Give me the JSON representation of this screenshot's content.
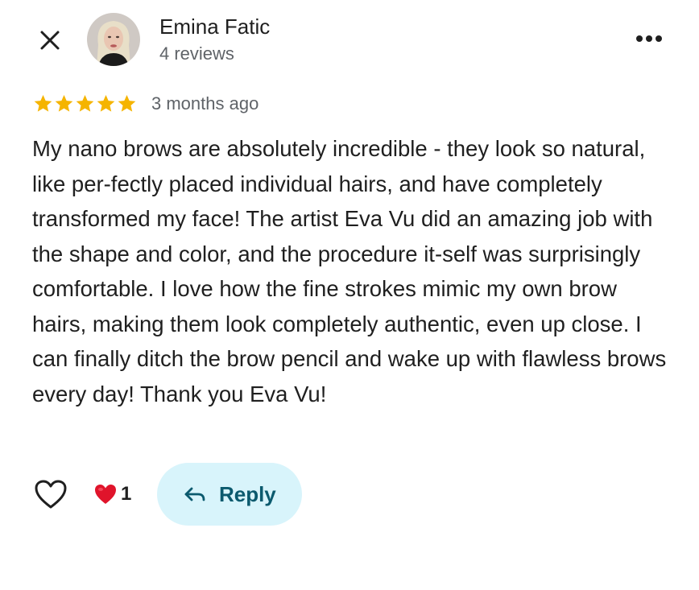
{
  "header": {
    "close_icon": "close-icon",
    "author_name": "Emina Fatic",
    "author_reviews": "4 reviews",
    "more_icon": "more-horizontal-icon"
  },
  "review": {
    "rating": 5,
    "rating_max": 5,
    "date": "3 months ago",
    "text": "My nano brows are absolutely incredible - they look so natural, like per-fectly placed individual hairs, and have completely transformed my face! The artist Eva Vu did an amazing job with the shape and color, and the procedure it-self was surprisingly comfortable. I  love how the fine strokes mimic my own brow hairs, making them look completely authentic, even up close. I can finally ditch the brow pencil and wake up with flawless brows every day! Thank you Eva Vu!"
  },
  "actions": {
    "like_icon": "heart-outline-icon",
    "reaction_icon": "red-heart-icon",
    "reaction_count": "1",
    "reply_icon": "reply-arrow-icon",
    "reply_label": "Reply"
  },
  "colors": {
    "star": "#f5b400",
    "text": "#1f1f1f",
    "muted": "#5f6368",
    "reply_bg": "#d8f4fb",
    "reply_text": "#0b5a6e",
    "heart_red": "#e0142b"
  }
}
